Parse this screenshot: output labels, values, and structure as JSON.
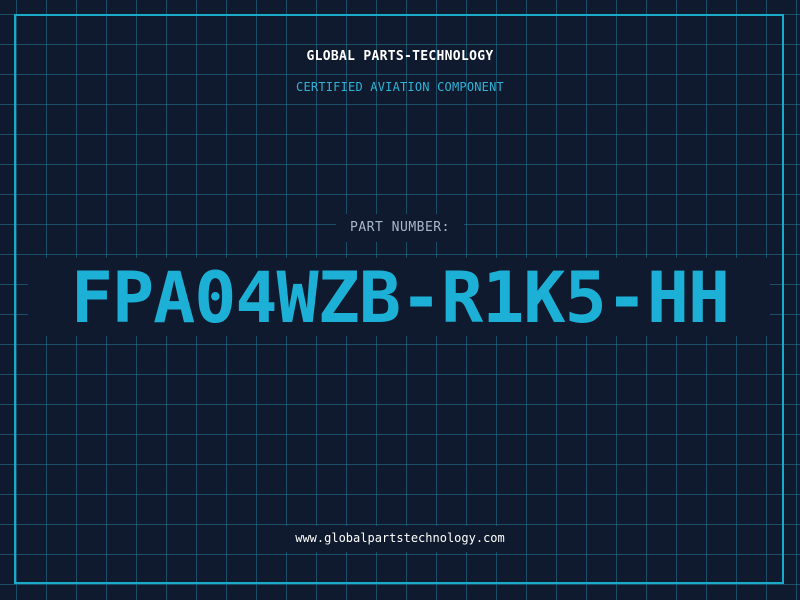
{
  "header": {
    "company": "GLOBAL PARTS-TECHNOLOGY",
    "subtitle": "CERTIFIED AVIATION COMPONENT"
  },
  "part": {
    "label": "PART NUMBER:",
    "number": "FPA04WZB-R1K5-HH"
  },
  "footer": {
    "url": "www.globalpartstechnology.com"
  },
  "colors": {
    "background": "#0f1a2e",
    "grid": "#26789b",
    "accent": "#1cb0d6",
    "frame": "#1aa9c9",
    "label": "#a9b8c9",
    "text": "#ffffff"
  }
}
